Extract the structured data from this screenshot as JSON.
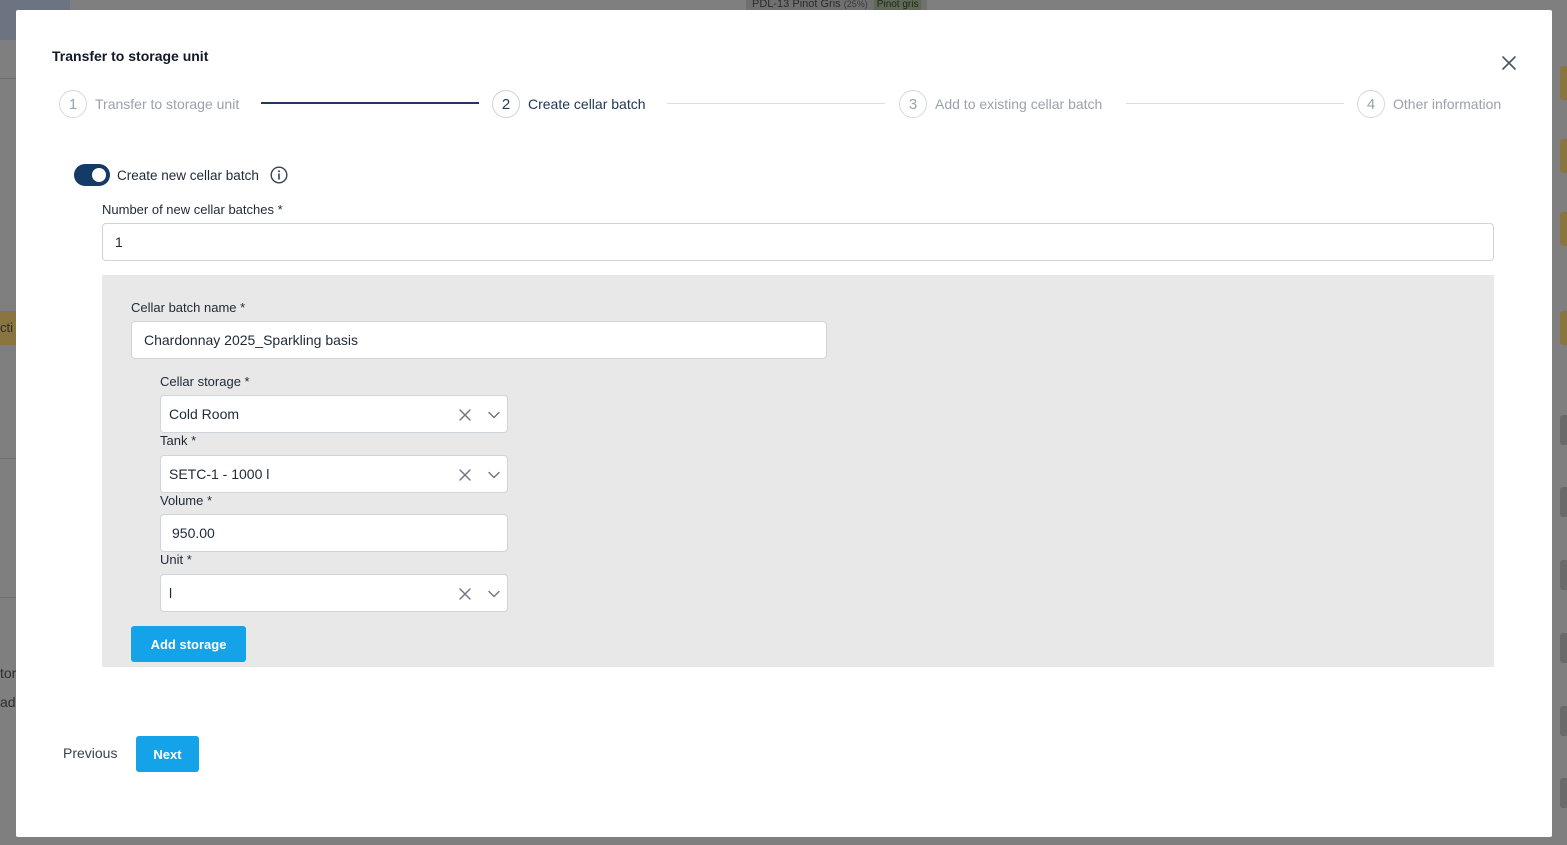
{
  "background": {
    "tag_text": "PDL-13 Pinot Gris",
    "tag_pct": "(25%)",
    "tag_chip": "Pinot gris",
    "left_badge_text": "cti",
    "left_text_1": "tor",
    "left_text_2": "ad"
  },
  "modal": {
    "title": "Transfer to storage unit",
    "close_icon": "close-icon"
  },
  "stepper": {
    "steps": [
      {
        "number": "1",
        "label": "Transfer to storage unit"
      },
      {
        "number": "2",
        "label": "Create cellar batch"
      },
      {
        "number": "3",
        "label": "Add to existing cellar batch"
      },
      {
        "number": "4",
        "label": "Other information"
      }
    ],
    "active_index": 1
  },
  "toggle": {
    "label": "Create new cellar batch",
    "on": true,
    "info_icon": "info-icon"
  },
  "num_batches": {
    "label": "Number of new cellar batches *",
    "value": "1"
  },
  "batch": {
    "name_label": "Cellar batch name *",
    "name_value": "Chardonnay 2025_Sparkling basis",
    "cellar_storage_label": "Cellar storage *",
    "cellar_storage_value": "Cold Room",
    "tank_label": "Tank *",
    "tank_value": "SETC-1 - 1000 l",
    "volume_label": "Volume *",
    "volume_value": "950.00",
    "unit_label": "Unit *",
    "unit_value": "l",
    "add_storage_label": "Add storage"
  },
  "footer": {
    "previous_label": "Previous",
    "next_label": "Next"
  },
  "colors": {
    "primary_button": "#14a3e8",
    "toggle_on": "#143a66",
    "stepper_done_line": "#1e3a5f",
    "panel_bg": "#e8e8e8"
  }
}
